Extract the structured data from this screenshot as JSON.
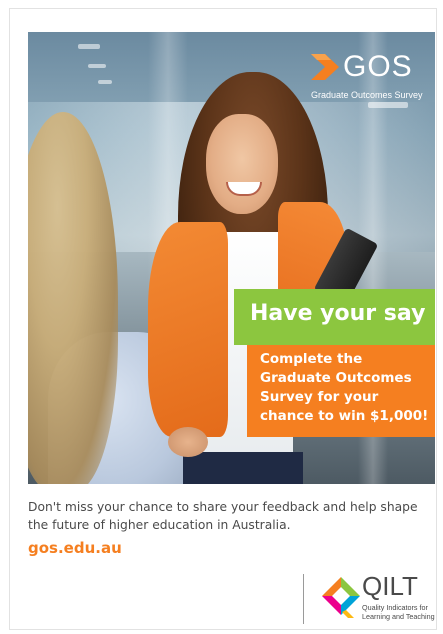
{
  "hero": {
    "logo_name": "GOS",
    "logo_subtitle": "Graduate Outcomes Survey",
    "headline": "Have your say",
    "offer_lines": [
      "Complete the",
      "Graduate Outcomes",
      "Survey for your",
      "chance to win $1,000!"
    ]
  },
  "body": {
    "description": "Don't miss your chance to share your feedback and help shape the future of higher education in Australia.",
    "url": "gos.edu.au"
  },
  "footer": {
    "logo_name": "QILT",
    "logo_subtitle_lines": [
      "Quality Indicators for",
      "Learning and Teaching"
    ]
  },
  "colors": {
    "accent_orange": "#f57f20",
    "accent_green": "#8cc63f",
    "text_gray": "#4a4a4a"
  },
  "icons": {
    "gos_mark": "orange-chevron-icon",
    "qilt_mark": "multicolor-q-icon"
  }
}
